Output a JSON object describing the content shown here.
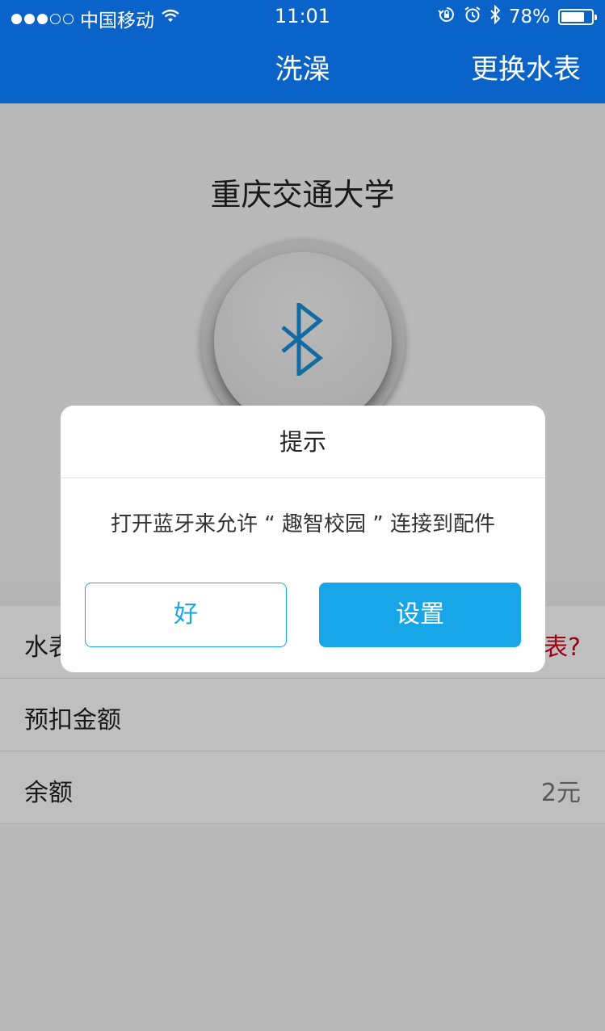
{
  "status_bar": {
    "carrier": "中国移动",
    "time": "11:01",
    "battery": "78%",
    "battery_level": 0.78
  },
  "nav": {
    "title": "洗澡",
    "right_action": "更换水表"
  },
  "main": {
    "school": "重庆交通大学",
    "rows": [
      {
        "label": "水表",
        "value": "表?"
      },
      {
        "label": "预扣金额",
        "value": ""
      },
      {
        "label": "余额",
        "value": "2元"
      }
    ]
  },
  "dialog": {
    "title": "提示",
    "message": "打开蓝牙来允许 “ 趣智校园 ” 连接到配件",
    "ok_label": "好",
    "settings_label": "设置"
  },
  "colors": {
    "nav_bg": "#0a63c9",
    "accent": "#17a6e8",
    "warning": "#d0021b"
  },
  "icons": [
    "signal-dots-icon",
    "wifi-icon",
    "rotation-lock-icon",
    "alarm-icon",
    "bluetooth-status-icon",
    "battery-icon",
    "bluetooth-icon"
  ]
}
